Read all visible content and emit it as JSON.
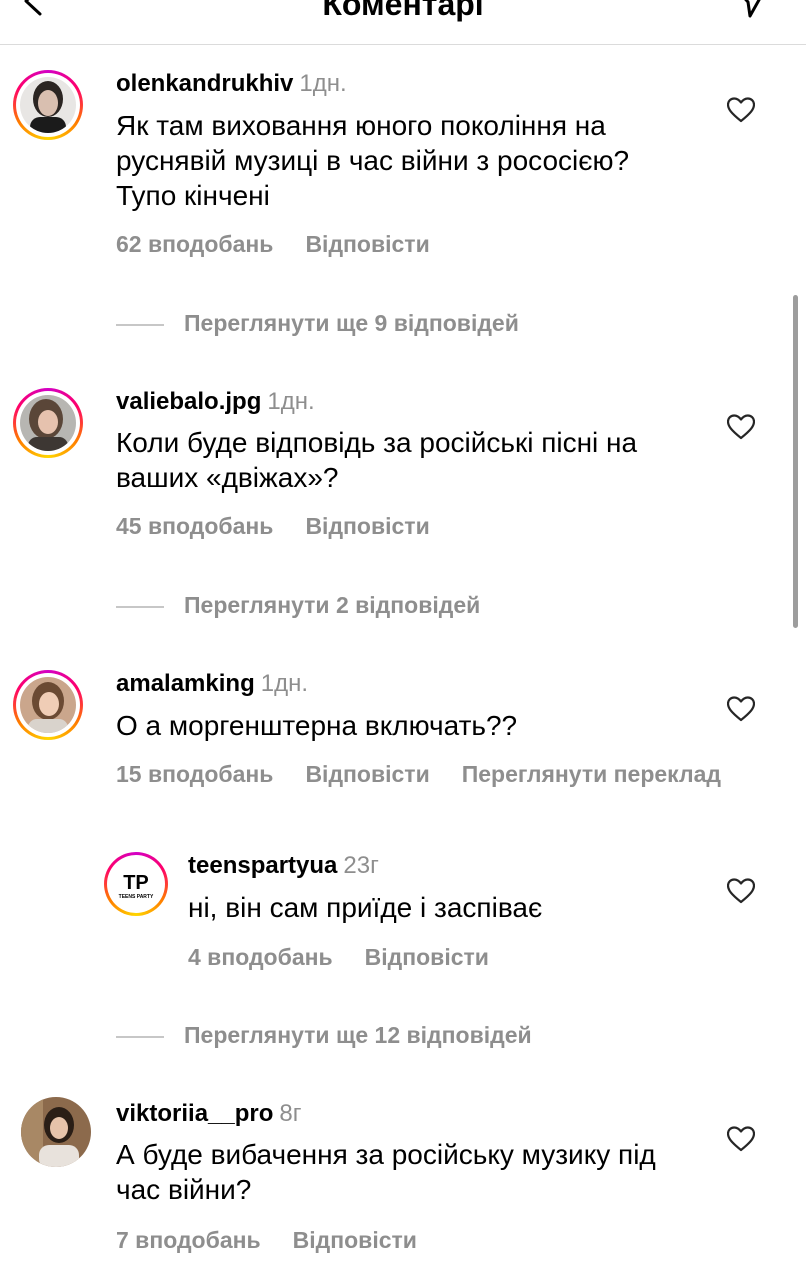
{
  "header": {
    "title": "Коментарі"
  },
  "comments": [
    {
      "username": "olenkandrukhiv",
      "time": "1дн.",
      "text": "Як там виховання юного покоління на руснявій музиці в час війни з рососією? Тупо кінчені",
      "likes": "62 вподобань",
      "reply": "Відповісти",
      "view_more": "Переглянути ще 9 відповідей"
    },
    {
      "username": "valiebalo.jpg",
      "time": "1дн.",
      "text": "Коли буде відповідь за російські пісні на ваших «двіжах»?",
      "likes": "45 вподобань",
      "reply": "Відповісти",
      "view_more": "Переглянути 2 відповідей"
    },
    {
      "username": "amalamking",
      "time": "1дн.",
      "text": "О а моргенштерна включать??",
      "likes": "15 вподобань",
      "reply": "Відповісти",
      "translate": "Переглянути переклад"
    },
    {
      "username": "teenspartyua",
      "time": "23г",
      "text": "ні, він сам приїде і заспіває",
      "likes": "4 вподобань",
      "reply": "Відповісти",
      "logo_main": "TP",
      "logo_sub": "TEENS PARTY",
      "view_more": "Переглянути ще 12 відповідей"
    },
    {
      "username": "viktoriia__pro",
      "time": "8г",
      "text": "А буде вибачення за російську музику під час війни?",
      "likes": "7 вподобань",
      "reply": "Відповісти"
    }
  ],
  "colors": {
    "muted": "#8e8e8e",
    "divider": "#dbdbdb",
    "ring_start": "#d300c5",
    "ring_end": "#ffd600"
  }
}
